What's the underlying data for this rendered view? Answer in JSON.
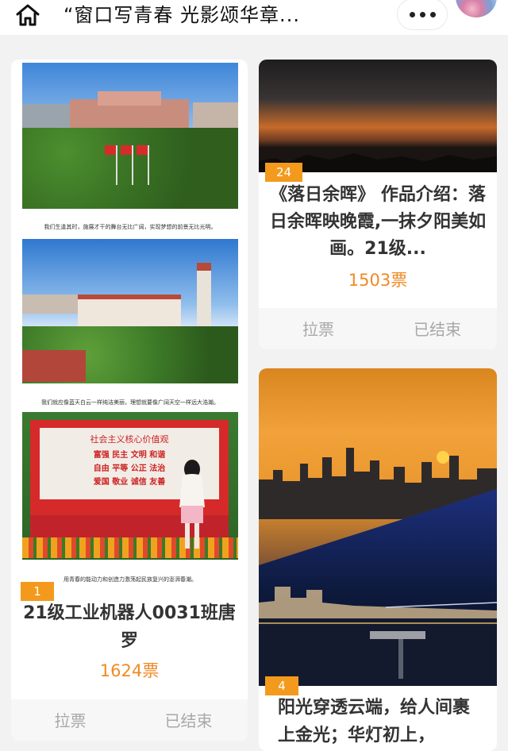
{
  "header": {
    "title": "“窗口写青春 光影颂华章...",
    "home_icon": "home-icon",
    "more_icon": "more-dots-icon"
  },
  "entries": [
    {
      "badge": "1",
      "title": "21级工业机器人0031班唐罗",
      "votes": "1624票",
      "vote_label": "拉票",
      "status_label": "已结束",
      "captions": [
        "我们生逢其时，施展才干的舞台无比广阔，实现梦想的前景无比光明。",
        "我们就应像蓝天白云一样纯洁美丽，理想就要像广阔天空一样远大浩瀚。",
        "用青春的能动力和创造力激荡起民族复兴的澎湃春潮。"
      ],
      "board_text": "社会主义核心价值观",
      "board_lines": [
        "富强 民主 文明 和谐",
        "自由 平等 公正 法治",
        "爱国 敬业 诚信 友善"
      ]
    },
    {
      "badge": "24",
      "title": "《落日余晖》 作品介绍：落日余晖映晚霞,一抹夕阳美如画。21级...",
      "votes": "1503票",
      "vote_label": "拉票",
      "status_label": "已结束"
    },
    {
      "badge": "4",
      "title": "阳光穿透云端，给人间裹上金光；华灯初上，"
    }
  ],
  "colors": {
    "accent": "#f39a1d",
    "votes": "#f08a24",
    "muted": "#a8a8a8",
    "background": "#f2f2f2"
  }
}
